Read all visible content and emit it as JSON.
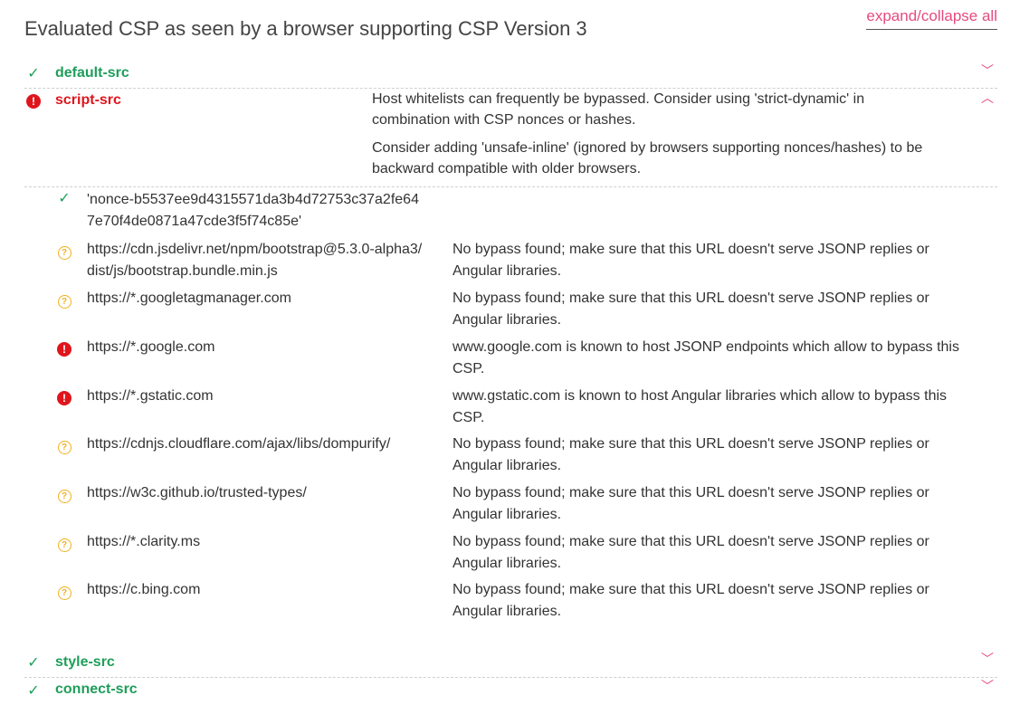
{
  "header": {
    "title": "Evaluated CSP as seen by a browser supporting CSP Version 3",
    "expand_collapse": "expand/collapse all"
  },
  "icons": {
    "ok": "check-icon",
    "error": "error-icon",
    "warning": "question-icon",
    "expand": "chevron-down-icon",
    "collapse": "chevron-up-icon"
  },
  "colors": {
    "ok": "#1e9e5a",
    "error": "#e0151c",
    "warning": "#f2b01e",
    "accent": "#e64a80"
  },
  "directives": {
    "default_src": {
      "name": "default-src"
    },
    "script_src": {
      "name": "script-src",
      "messages": [
        "Host whitelists can frequently be bypassed. Consider using 'strict-dynamic' in combination with CSP nonces or hashes.",
        "Consider adding 'unsafe-inline' (ignored by browsers supporting nonces/hashes) to be backward compatible with older browsers."
      ],
      "values": [
        {
          "value": "'nonce-b5537ee9d4315571da3b4d72753c37a2fe647e70f4de0871a47cde3f5f74c85e'",
          "status": "ok",
          "note": ""
        },
        {
          "value": "https://cdn.jsdelivr.net/npm/bootstrap@5.3.0-alpha3/dist/js/bootstrap.bundle.min.js",
          "status": "warning",
          "note": "No bypass found; make sure that this URL doesn't serve JSONP replies or Angular libraries."
        },
        {
          "value": "https://*.googletagmanager.com",
          "status": "warning",
          "note": "No bypass found; make sure that this URL doesn't serve JSONP replies or Angular libraries."
        },
        {
          "value": "https://*.google.com",
          "status": "error",
          "note": "www.google.com is known to host JSONP endpoints which allow to bypass this CSP."
        },
        {
          "value": "https://*.gstatic.com",
          "status": "error",
          "note": "www.gstatic.com is known to host Angular libraries which allow to bypass this CSP."
        },
        {
          "value": "https://cdnjs.cloudflare.com/ajax/libs/dompurify/",
          "status": "warning",
          "note": "No bypass found; make sure that this URL doesn't serve JSONP replies or Angular libraries."
        },
        {
          "value": "https://w3c.github.io/trusted-types/",
          "status": "warning",
          "note": "No bypass found; make sure that this URL doesn't serve JSONP replies or Angular libraries."
        },
        {
          "value": "https://*.clarity.ms",
          "status": "warning",
          "note": "No bypass found; make sure that this URL doesn't serve JSONP replies or Angular libraries."
        },
        {
          "value": "https://c.bing.com",
          "status": "warning",
          "note": "No bypass found; make sure that this URL doesn't serve JSONP replies or Angular libraries."
        }
      ]
    },
    "style_src": {
      "name": "style-src"
    },
    "connect_src": {
      "name": "connect-src"
    }
  }
}
